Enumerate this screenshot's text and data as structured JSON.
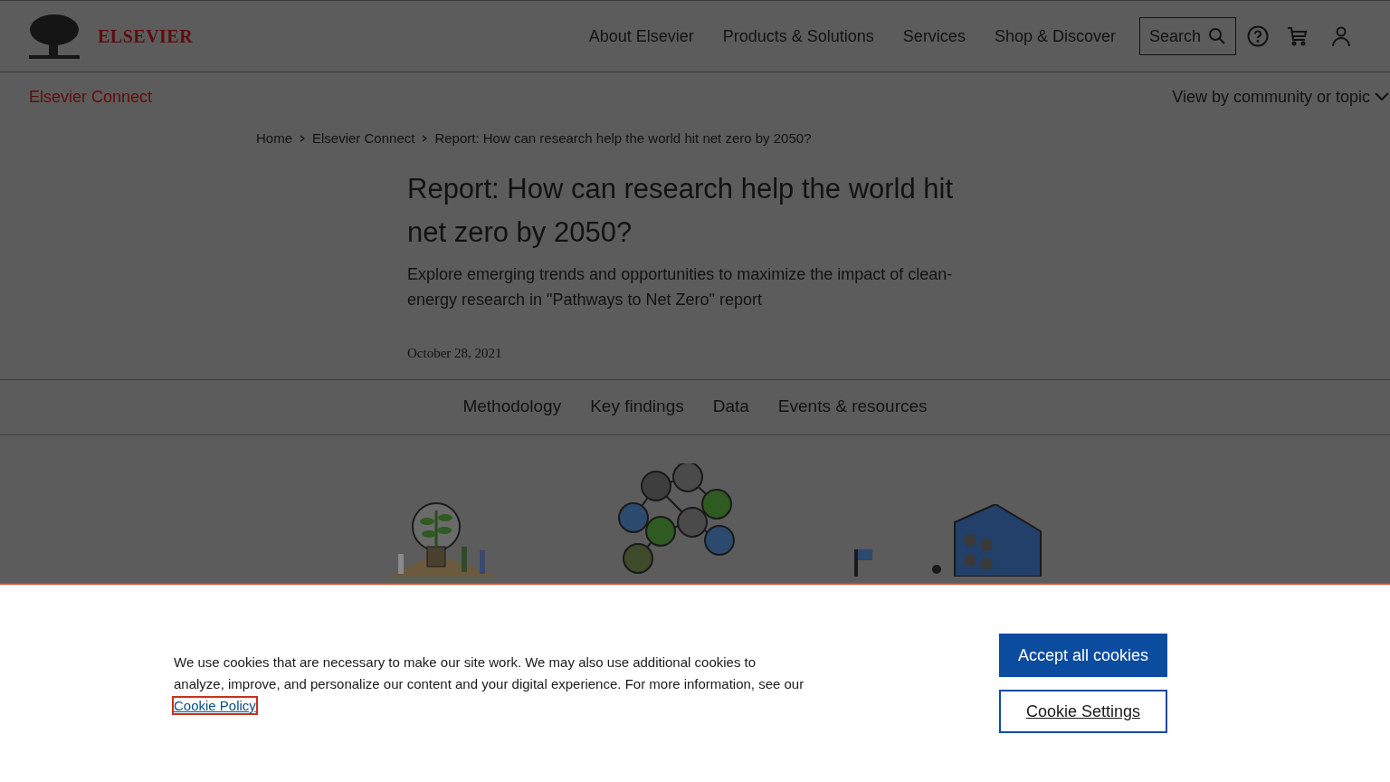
{
  "header": {
    "logo_text": "ELSEVIER",
    "nav": [
      "About Elsevier",
      "Products & Solutions",
      "Services",
      "Shop & Discover"
    ],
    "search": "Search"
  },
  "subnav": {
    "title": "Elsevier Connect",
    "menu": "View by community or topic"
  },
  "breadcrumb": [
    "Home",
    "Elsevier Connect",
    "Report: How can research help the world hit net zero by 2050?"
  ],
  "article": {
    "title": "Report: How can research help the world hit net zero by 2050?",
    "subtitle": "Explore emerging trends and opportunities to maximize the impact of clean-energy research in \"Pathways to Net Zero\" report",
    "date": "October 28, 2021"
  },
  "section_tabs": [
    "Methodology",
    "Key findings",
    "Data",
    "Events & resources"
  ],
  "cookie_banner": {
    "text": "We use cookies that are necessary to make our site work. We may also use additional cookies to analyze, improve, and personalize our content and your digital experience. For more information, see our",
    "link": "Cookie Policy",
    "buttons": [
      {
        "kind": "primary",
        "label": "Accept all cookies"
      },
      {
        "kind": "outline",
        "label": "Cookie Settings"
      }
    ]
  }
}
